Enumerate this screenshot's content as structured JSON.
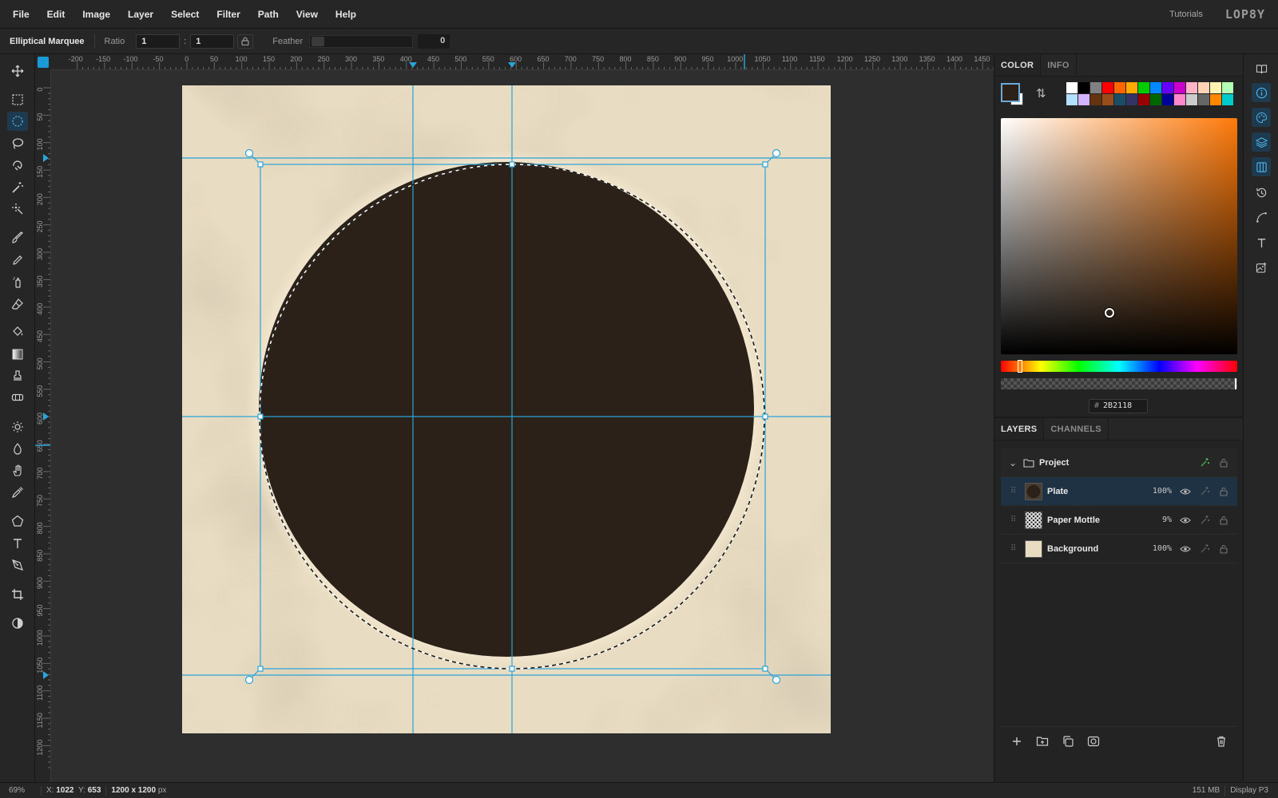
{
  "menubar": {
    "items": [
      "File",
      "Edit",
      "Image",
      "Layer",
      "Select",
      "Filter",
      "Path",
      "View",
      "Help"
    ],
    "tutorials": "Tutorials",
    "logo": "LOP8Y"
  },
  "options": {
    "tool_name": "Elliptical Marquee",
    "ratio_label": "Ratio",
    "ratio_w": "1",
    "ratio_sep": ":",
    "ratio_h": "1",
    "feather_label": "Feather",
    "feather_value": "0"
  },
  "rulers": {
    "top_labels": [
      "-200",
      "-150",
      "-100",
      "-50",
      "0",
      "50",
      "100",
      "150",
      "200",
      "250",
      "300",
      "350",
      "400",
      "450",
      "500",
      "550",
      "600",
      "650",
      "700",
      "750",
      "800",
      "850",
      "900",
      "950",
      "1000",
      "1050",
      "1100",
      "1150",
      "1200",
      "1250",
      "1300",
      "1350",
      "1400",
      "1450"
    ],
    "left_labels": [
      "0",
      "50",
      "100",
      "150",
      "200",
      "250",
      "300",
      "350",
      "400",
      "450",
      "500",
      "550",
      "600",
      "650",
      "700",
      "750",
      "800",
      "850",
      "900",
      "950",
      "1000",
      "1050",
      "1100",
      "1150",
      "1200"
    ]
  },
  "tools": [
    {
      "name": "move-tool",
      "active": false
    },
    {
      "name": "rectangular-marquee-tool",
      "active": false
    },
    {
      "name": "elliptical-marquee-tool",
      "active": true
    },
    {
      "name": "lasso-tool",
      "active": false
    },
    {
      "name": "magnetic-lasso-tool",
      "active": false
    },
    {
      "name": "magic-wand-tool",
      "active": false
    },
    {
      "name": "quick-selection-tool",
      "active": false
    },
    {
      "name": "brush-tool",
      "active": false
    },
    {
      "name": "pencil-tool",
      "active": false
    },
    {
      "name": "spray-tool",
      "active": false
    },
    {
      "name": "eraser-tool",
      "active": false
    },
    {
      "name": "paint-bucket-tool",
      "active": false
    },
    {
      "name": "gradient-tool",
      "active": false
    },
    {
      "name": "clone-stamp-tool",
      "active": false
    },
    {
      "name": "healing-tool",
      "active": false
    },
    {
      "name": "dodge-tool",
      "active": false
    },
    {
      "name": "blur-tool",
      "active": false
    },
    {
      "name": "hand-tool",
      "active": false
    },
    {
      "name": "eyedropper-tool",
      "active": false
    },
    {
      "name": "shape-tool",
      "active": false
    },
    {
      "name": "type-tool",
      "active": false
    },
    {
      "name": "pen-tool",
      "active": false
    },
    {
      "name": "crop-tool",
      "active": false
    },
    {
      "name": "quick-mask-toggle",
      "active": false
    }
  ],
  "panel": {
    "color_tabs": [
      "COLOR",
      "INFO"
    ],
    "fg_color": "#2B2118",
    "bg_color": "#FFFFFF",
    "hex_value": "2B2118",
    "hex_hash": "#",
    "palette": [
      "#FFFFFF",
      "#000000",
      "#808080",
      "#FF0000",
      "#FF6600",
      "#FFAA00",
      "#00CC00",
      "#0088FF",
      "#6600FF",
      "#CC00CC",
      "#FFB3C6",
      "#FFD3B3",
      "#FFF5B3",
      "#B3FFB3",
      "#B3E0FF",
      "#D3B3FF",
      "#663311",
      "#994D1A",
      "#1A4D66",
      "#333366",
      "#990000",
      "#006600",
      "#000099",
      "#FF88CC",
      "#CCCCCC",
      "#666666",
      "#FF8800",
      "#00CCCC"
    ],
    "layers_tabs": [
      "LAYERS",
      "CHANNELS"
    ],
    "layers": [
      {
        "name": "Project",
        "type": "group",
        "opacity": ""
      },
      {
        "name": "Plate",
        "type": "layer",
        "opacity": "100%",
        "selected": true
      },
      {
        "name": "Paper Mottle",
        "type": "layer",
        "opacity": "9%"
      },
      {
        "name": "Background",
        "type": "layer",
        "opacity": "100%"
      }
    ]
  },
  "canvas": {
    "plate_color": "#2B2118",
    "paper_color": "#E8DCC2",
    "guide_color": "#2AA3D9"
  },
  "status": {
    "zoom": "69%",
    "x_label": "X:",
    "x": "1022",
    "y_label": "Y:",
    "y": "653",
    "dims": "1200 x 1200",
    "unit": "px",
    "memory": "151 MB",
    "profile": "Display P3"
  }
}
